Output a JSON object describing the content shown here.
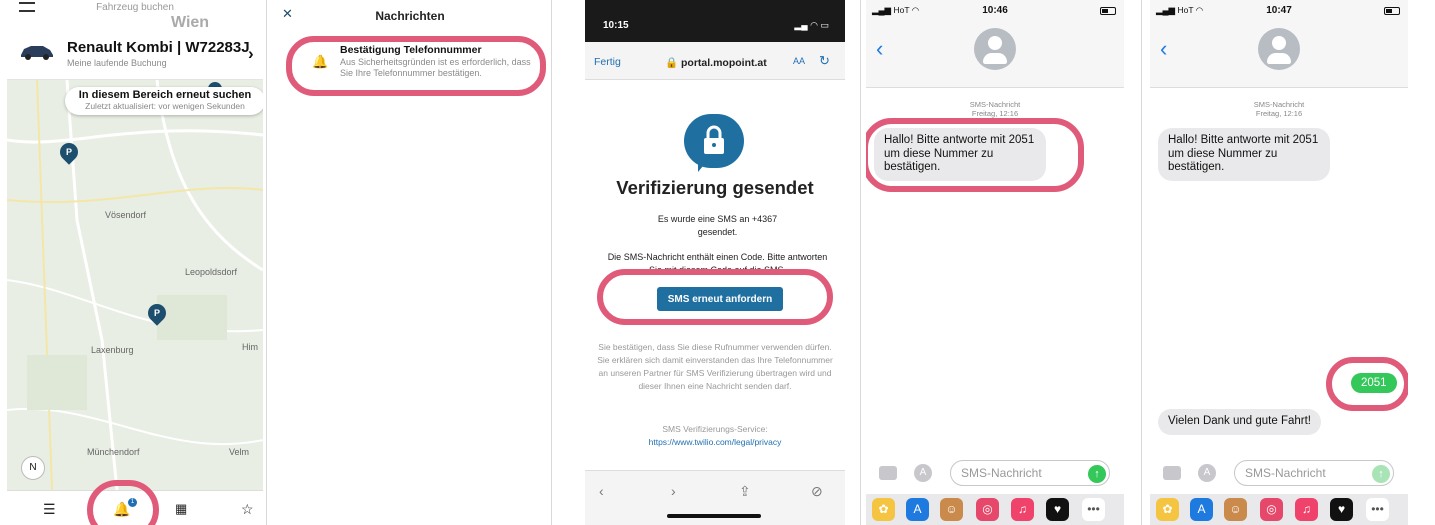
{
  "panel1": {
    "top_label": "Fahrzeug buchen",
    "vehicle_title": "Renault Kombi | W72283J",
    "vehicle_sub": "Meine laufende Buchung",
    "search_title": "In diesem Bereich erneut suchen",
    "search_sub": "Zuletzt aktualisiert: vor wenigen Sekunden",
    "towns": [
      "Wien",
      "Vösendorf",
      "Leopoldsdorf",
      "Laxenburg",
      "Münchendorf",
      "Him",
      "Velm"
    ],
    "pin_label": "P",
    "compass": "N",
    "badge": "1"
  },
  "panel2": {
    "title": "Nachrichten",
    "notif_title": "Bestätigung Telefonnummer",
    "notif_body": "Aus Sicherheitsgründen ist es erforderlich, dass Sie Ihre Telefonnummer bestätigen."
  },
  "panel3": {
    "time": "10:15",
    "fertig": "Fertig",
    "url": "portal.mopoint.at",
    "aa": "AA",
    "title": "Verifizierung gesendet",
    "sent_text_1": "Es wurde eine SMS an +4367",
    "sent_text_2": "gesendet.",
    "code_text": "Die SMS-Nachricht enthält einen Code. Bitte antworten Sie mit diesem Code auf die SMS.",
    "button": "SMS erneut anfordern",
    "legal": "Sie bestätigen, dass Sie diese Rufnummer verwenden dürfen. Sie erklären sich damit einverstanden das Ihre Telefonnummer an unseren Partner für SMS Verifizierung übertragen wird und dieser Ihnen eine Nachricht senden darf.",
    "service_label": "SMS Verifizierungs-Service:",
    "service_link": "https://www.twilio.com/legal/privacy"
  },
  "panel4": {
    "carrier": "HoT",
    "time": "10:46",
    "meta_1": "SMS-Nachricht",
    "meta_2": "Freitag, 12:16",
    "message": "Hallo! Bitte antworte mit 2051 um diese Nummer zu bestätigen.",
    "placeholder": "SMS-Nachricht"
  },
  "panel5": {
    "carrier": "HoT",
    "time": "10:47",
    "meta_1": "SMS-Nachricht",
    "meta_2": "Freitag, 12:16",
    "message": "Hallo! Bitte antworte mit 2051 um diese Nummer zu bestätigen.",
    "reply": "2051",
    "thanks": "Vielen Dank und gute Fahrt!",
    "placeholder": "SMS-Nachricht"
  },
  "colors": {
    "highlight": "#e05a7a",
    "brand": "#1f6fa0",
    "imessage_green": "#34c759",
    "link_blue": "#1f7ae0"
  }
}
